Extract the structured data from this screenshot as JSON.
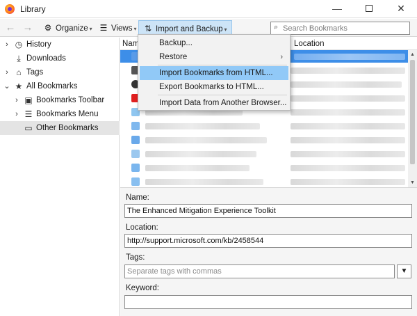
{
  "window": {
    "title": "Library",
    "minimize": "—",
    "maximize": "",
    "close": "✕"
  },
  "toolbar": {
    "back": "←",
    "forward": "→",
    "organize": "Organize",
    "views": "Views",
    "import_backup": "Import and Backup",
    "caret": "▾",
    "search_placeholder": "Search Bookmarks"
  },
  "sidebar": {
    "items": [
      {
        "label": "History",
        "icon": "clock-icon"
      },
      {
        "label": "Downloads",
        "icon": "download-icon"
      },
      {
        "label": "Tags",
        "icon": "tag-icon"
      },
      {
        "label": "All Bookmarks",
        "icon": "star-icon"
      },
      {
        "label": "Bookmarks Toolbar",
        "icon": "toolbar-icon"
      },
      {
        "label": "Bookmarks Menu",
        "icon": "menu-icon"
      },
      {
        "label": "Other Bookmarks",
        "icon": "folder-icon"
      }
    ]
  },
  "columns": {
    "name": "Name",
    "location": "Location"
  },
  "menu": {
    "items": [
      {
        "label": "Backup..."
      },
      {
        "label": "Restore",
        "submenu": "›"
      },
      {
        "label": "Import Bookmarks from HTML..."
      },
      {
        "label": "Export Bookmarks to HTML..."
      },
      {
        "label": "Import Data from Another Browser..."
      }
    ]
  },
  "details": {
    "name_label": "Name:",
    "name_value": "The Enhanced Mitigation Experience Toolkit",
    "location_label": "Location:",
    "location_value": "http://support.microsoft.com/kb/2458544",
    "tags_label": "Tags:",
    "tags_placeholder": "Separate tags with commas",
    "tags_dropdown": "▼",
    "keyword_label": "Keyword:",
    "keyword_value": ""
  },
  "colors": {
    "selection": "#3d8ee8",
    "menu_hover": "#91c9f7",
    "button_active": "#cde4f7"
  }
}
